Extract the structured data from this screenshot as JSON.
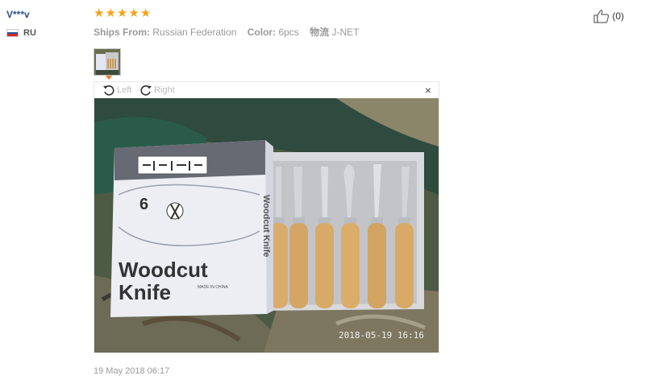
{
  "reviewer": {
    "name": "V***v",
    "country_code": "RU"
  },
  "review": {
    "rating": 5,
    "ships_from_label": "Ships From:",
    "ships_from_value": "Russian Federation",
    "color_label": "Color:",
    "color_value": "6pcs",
    "logistics_label": "物流",
    "logistics_value": "J-NET",
    "date": "19 May 2018 06:17"
  },
  "helpful": {
    "count": "(0)"
  },
  "viewer": {
    "rotate_left": "Left",
    "rotate_right": "Right",
    "close": "×"
  },
  "photo": {
    "box_title": "Woodcut",
    "box_title2": "Knife",
    "box_number": "6",
    "box_made_in": "MADE IN CHINA",
    "box_side": "Woodcut Knife",
    "timestamp": "2018-05-19  16:16"
  },
  "colors": {
    "star": "#f5a21a",
    "name": "#2b4f8f",
    "marker": "#f37a1f"
  }
}
